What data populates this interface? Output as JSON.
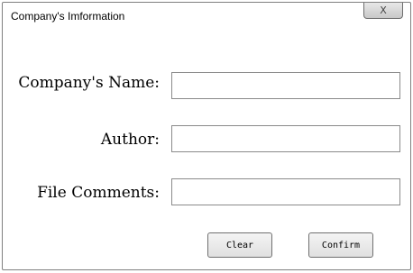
{
  "window": {
    "title": "Company's Imformation",
    "close_label": "X"
  },
  "form": {
    "company_name": {
      "label": "Company's Name:",
      "value": ""
    },
    "author": {
      "label": "Author:",
      "value": ""
    },
    "file_comments": {
      "label": "File Comments:",
      "value": ""
    }
  },
  "buttons": {
    "clear_label": "Clear",
    "confirm_label": "Confirm"
  }
}
